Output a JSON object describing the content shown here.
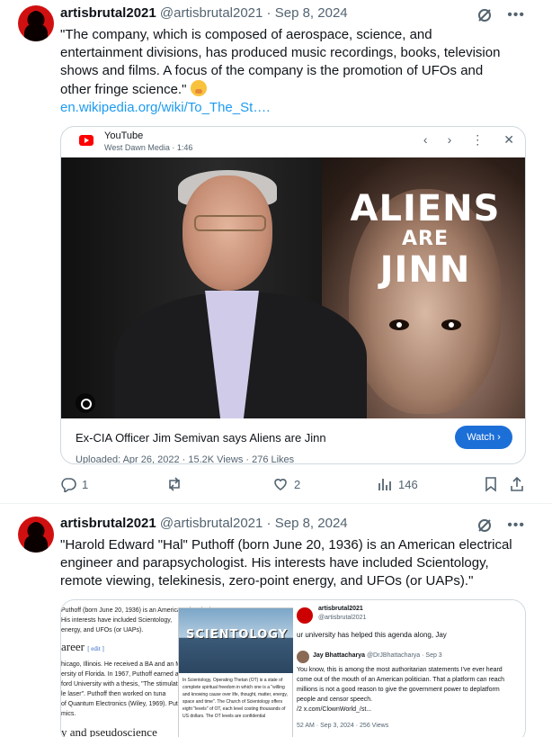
{
  "tweets": [
    {
      "author_name": "artisbrutal2021",
      "handle": "@artisbrutal2021",
      "dot": "·",
      "date": "Sep 8, 2024",
      "text_lines": [
        "\"The company, which is composed of aerospace, science, and",
        "entertainment divisions, has produced music recordings, books, television",
        "shows and films. A focus of the company is the promotion of UFOs and",
        "other fringe science.\""
      ],
      "emoji": "face-with-hand-over-mouth",
      "link": "en.wikipedia.org/wiki/To_The_St….",
      "card": {
        "source": "YouTube",
        "channel": "West Dawn Media · 1:46",
        "overlay_title_line1": "ALIENS",
        "overlay_title_line2": "ARE",
        "overlay_title_line3": "JINN",
        "video_title": "Ex-CIA Officer Jim Semivan says Aliens are Jinn",
        "meta": "Uploaded: Apr 26, 2022 · 15.2K Views · 276 Likes",
        "watch_label": "Watch ›",
        "nav_prev": "‹",
        "nav_next": "›",
        "nav_more": "⋮",
        "nav_close": "✕"
      },
      "actions": {
        "replies": "1",
        "reposts": "",
        "likes": "2",
        "views": "146"
      }
    },
    {
      "author_name": "artisbrutal2021",
      "handle": "@artisbrutal2021",
      "dot": "·",
      "date": "Sep 8, 2024",
      "text_lines": [
        "\"Harold Edward \"Hal\" Puthoff (born June 20, 1936) is an American electrical",
        "engineer and parapsychologist.  His interests have included Scientology,",
        "remote viewing, telekinesis, zero-point energy, and UFOs (or UAPs).\""
      ],
      "media": {
        "wiki_lines": [
          "Puthoff (born June 20, 1936) is an American electrical",
          "His interests have included Scientology,",
          "energy, and UFOs (or UAPs).",
          "hicago, Illinois. He received a BA and an MS",
          "ersity of Florida. In 1967, Puthoff earned a",
          "ford University with a thesis, \"The stimulated",
          "le laser\". Puthoff then worked on tuna",
          "of Quantum Electronics (Wiley, 1969). Puth",
          "mics."
        ],
        "wiki_heading": "areer",
        "wiki_edit": "[ edit ]",
        "wiki_bottom": "y and pseudoscience",
        "scientology_sign": "SCIENTOLOGY",
        "scientology_text": "In Scientology, Operating Thetan (OT) is a state of complete spiritual freedom in which one is a \"willing and knowing cause over life, thought, matter, energy, space and time\". The Church of Scientology offers eight \"levels\" of OT, each level costing thousands of US dollars. The OT levels are confidential",
        "shot_name": "artisbrutal2021",
        "shot_handle": "@artisbrutal2021",
        "shot_line": "ur university has helped this agenda along, Jay",
        "quote_name": "Jay Bhattacharya",
        "quote_handle": "@DrJBhattacharya · Sep 3",
        "quote_lines": [
          "You know, this is among the most authoritarian statements I've ever heard",
          "come out of the mouth of an American politician. That a platform can reach",
          "millions is not a good reason to give the government power to deplatform",
          "people and censor speech.",
          "/2 x.com/ClownWorld_/st..."
        ],
        "quote_time": "52 AM · Sep 3, 2024 · 256 Views"
      }
    }
  ]
}
